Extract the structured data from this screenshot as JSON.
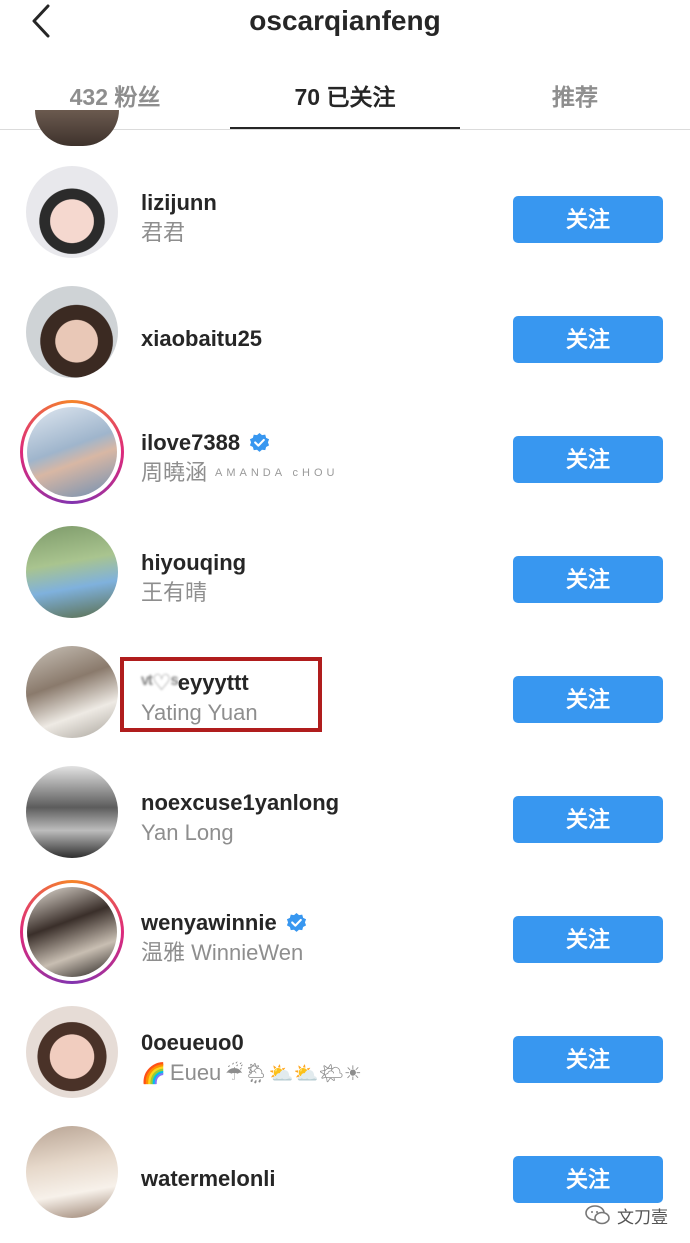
{
  "header": {
    "title": "oscarqianfeng",
    "back_icon": "chevron-left-icon"
  },
  "tabs": [
    {
      "label": "432 粉丝",
      "active": false
    },
    {
      "label": "70 已关注",
      "active": true
    },
    {
      "label": "推荐",
      "active": false
    }
  ],
  "users": [
    {
      "username": "lizijunn",
      "display_name": "君君",
      "verified": false,
      "story_ring": false,
      "button": "关注"
    },
    {
      "username": "xiaobaitu25",
      "display_name": "",
      "verified": false,
      "story_ring": false,
      "button": "关注"
    },
    {
      "username": "ilove7388",
      "display_name": "周曉涵",
      "tagline": "AMANDA cHOU",
      "verified": true,
      "story_ring": true,
      "button": "关注"
    },
    {
      "username": "hiyouqing",
      "display_name": "王有晴",
      "verified": false,
      "story_ring": false,
      "button": "关注"
    },
    {
      "username_visible": "eyyyttt",
      "display_name": "Yating Yuan",
      "verified": false,
      "story_ring": false,
      "highlighted": true,
      "button": "关注"
    },
    {
      "username": "noexcuse1yanlong",
      "display_name": "Yan Long",
      "verified": false,
      "story_ring": false,
      "button": "关注"
    },
    {
      "username": "wenyawinnie",
      "display_name": "温雅 WinnieWen",
      "verified": true,
      "story_ring": true,
      "button": "关注"
    },
    {
      "username": "0oeueuo0",
      "display_name": "Eueu",
      "display_emojis": [
        "🌈",
        "☔",
        "🌦",
        "⛅",
        "⛅",
        "🌤",
        "☀"
      ],
      "verified": false,
      "story_ring": false,
      "button": "关注"
    },
    {
      "username": "watermelonli",
      "display_name": "",
      "verified": false,
      "story_ring": false,
      "button": "关注"
    }
  ],
  "watermark": {
    "text": "文刀壹"
  },
  "colors": {
    "follow_button": "#3897f0",
    "verified_badge": "#3897f0",
    "highlight_box": "#b01d1d"
  }
}
